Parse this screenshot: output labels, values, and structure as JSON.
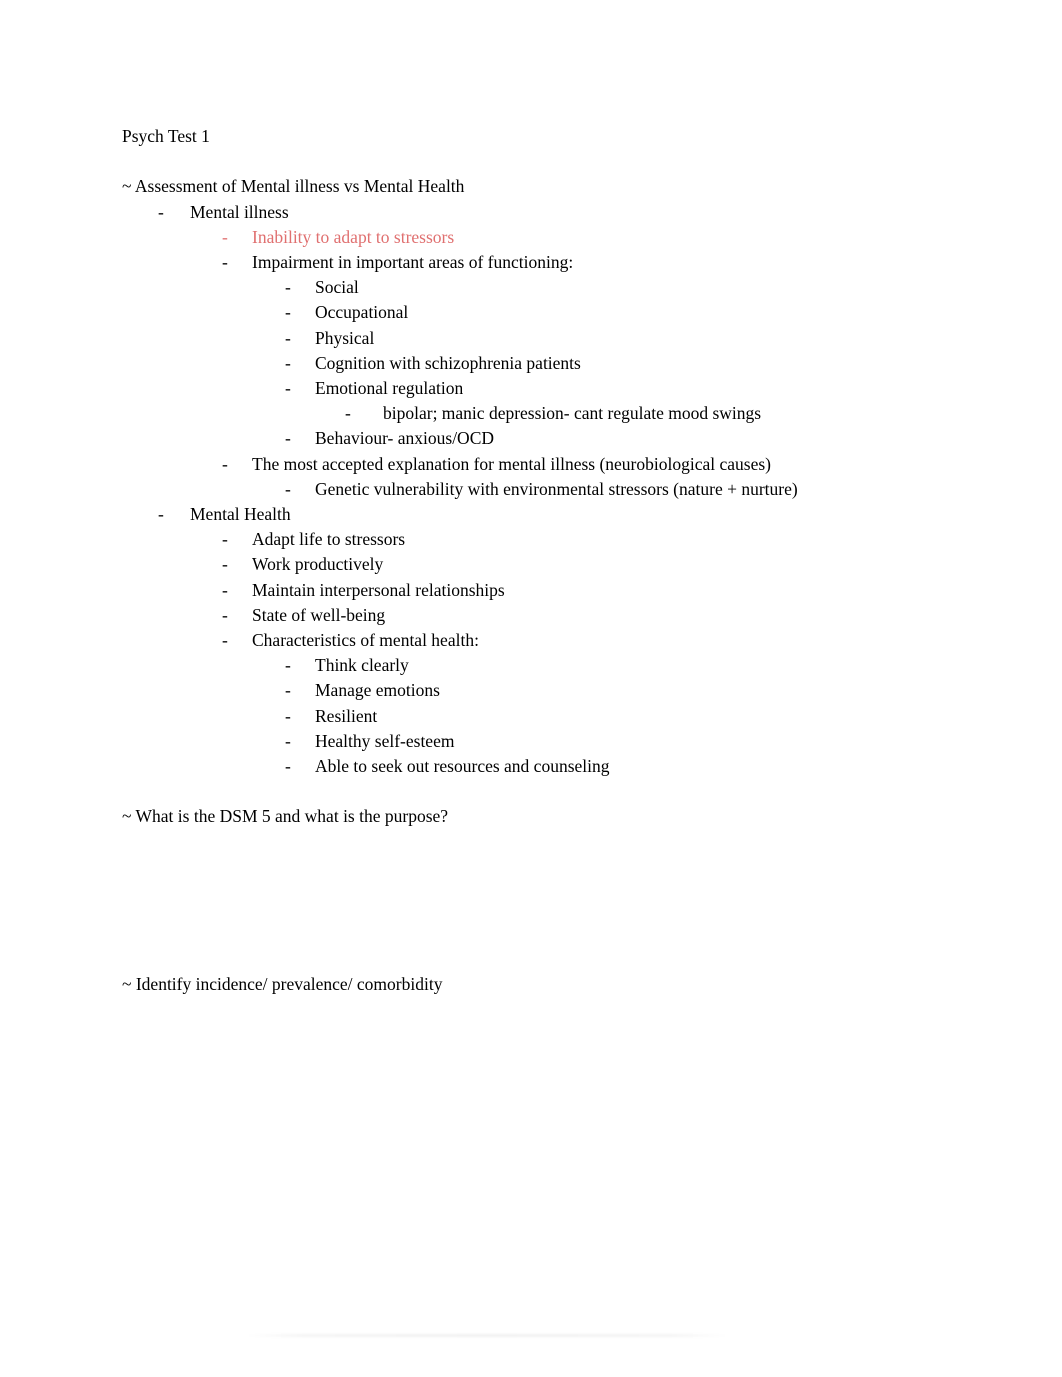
{
  "document": {
    "title": "Psych Test 1",
    "accent_red": "#e07070",
    "text_color": "#000000",
    "background": "#ffffff",
    "bullet_dash": "-",
    "section_marker": "~"
  },
  "blocks": [
    {
      "heading": "~ Assessment of Mental illness vs Mental Health",
      "items": [
        {
          "level": 1,
          "text": "Mental illness",
          "color": "black"
        },
        {
          "level": 2,
          "text": "Inability to adapt to stressors",
          "color": "red"
        },
        {
          "level": 2,
          "text": "Impairment in important areas of functioning:",
          "color": "black"
        },
        {
          "level": 3,
          "text": "Social",
          "color": "black"
        },
        {
          "level": 3,
          "text": "Occupational",
          "color": "black"
        },
        {
          "level": 3,
          "text": "Physical",
          "color": "black"
        },
        {
          "level": 3,
          "text": "Cognition with schizophrenia patients",
          "color": "black"
        },
        {
          "level": 3,
          "text": "Emotional regulation",
          "color": "black"
        },
        {
          "level": 4,
          "text": "bipolar; manic depression- cant regulate mood swings",
          "color": "black"
        },
        {
          "level": 3,
          "text": "Behaviour- anxious/OCD",
          "color": "black"
        },
        {
          "level": 2,
          "text": "The most accepted explanation for mental illness (neurobiological causes)",
          "color": "black"
        },
        {
          "level": 3,
          "text": "Genetic vulnerability with environmental stressors (nature + nurture)",
          "color": "black"
        },
        {
          "level": 1,
          "text": "Mental Health",
          "color": "black"
        },
        {
          "level": 2,
          "text": "Adapt life to stressors",
          "color": "black"
        },
        {
          "level": 2,
          "text": "Work productively",
          "color": "black"
        },
        {
          "level": 2,
          "text": "Maintain interpersonal relationships",
          "color": "black"
        },
        {
          "level": 2,
          "text": "State of well-being",
          "color": "black"
        },
        {
          "level": 2,
          "text": "Characteristics of mental health:",
          "color": "black"
        },
        {
          "level": 3,
          "text": "Think clearly",
          "color": "black"
        },
        {
          "level": 3,
          "text": "Manage emotions",
          "color": "black"
        },
        {
          "level": 3,
          "text": "Resilient",
          "color": "black"
        },
        {
          "level": 3,
          "text": "Healthy self-esteem",
          "color": "black"
        },
        {
          "level": 3,
          "text": "Able to seek out resources and counseling",
          "color": "black"
        }
      ]
    },
    {
      "heading": "~ What is the DSM 5 and what is the purpose?",
      "items": []
    },
    {
      "heading": "~ Identify incidence/ prevalence/ comorbidity",
      "items": []
    }
  ]
}
